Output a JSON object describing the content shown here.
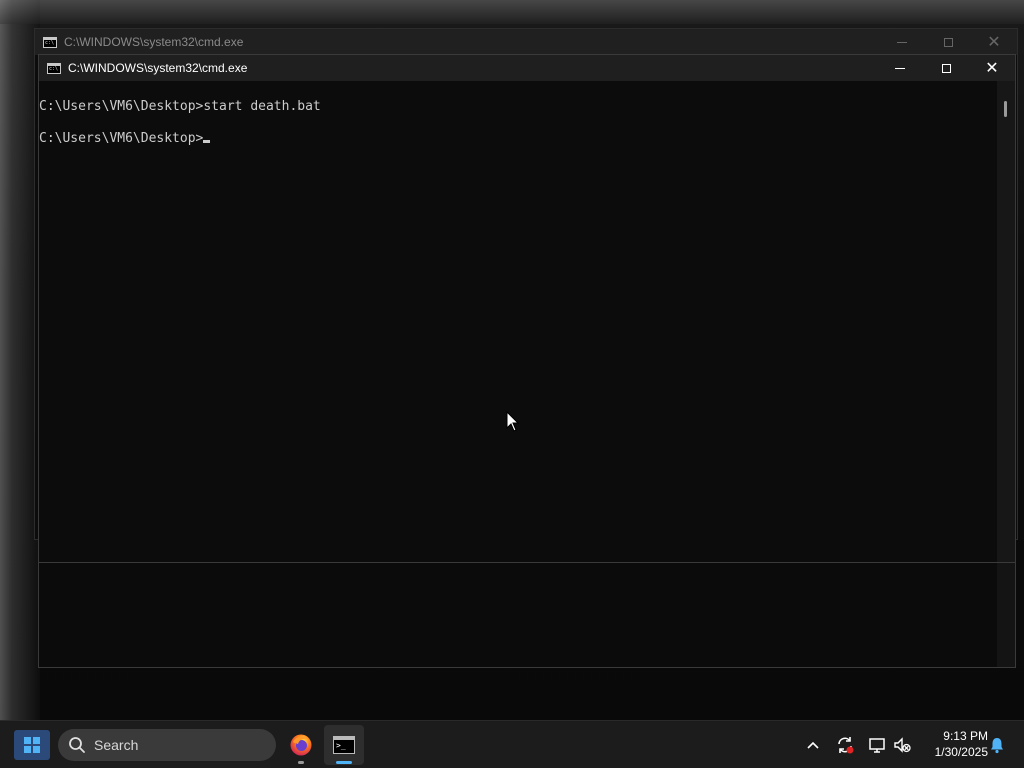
{
  "windows": {
    "back": {
      "title": "C:\\WINDOWS\\system32\\cmd.exe"
    },
    "front": {
      "title": "C:\\WINDOWS\\system32\\cmd.exe",
      "console_lines": [
        "C:\\Users\\VM6\\Desktop>start death.bat",
        "C:\\Users\\VM6\\Desktop>"
      ]
    }
  },
  "taskbar": {
    "search_label": "Search",
    "apps": [
      {
        "name": "firefox",
        "icon": "firefox-icon"
      },
      {
        "name": "command-prompt",
        "icon": "cmd-icon",
        "active": true
      }
    ],
    "tray_icons": [
      "chevron-up-icon",
      "sync-icon",
      "network-icon",
      "volume-muted-icon",
      "notification-bell-icon"
    ],
    "time": "9:13 PM",
    "date": "1/30/2025"
  },
  "colors": {
    "console_bg": "#0c0c0c",
    "console_text": "#cccccc",
    "accent": "#4fb3f6",
    "taskbar_bg": "#1c1c1c"
  }
}
